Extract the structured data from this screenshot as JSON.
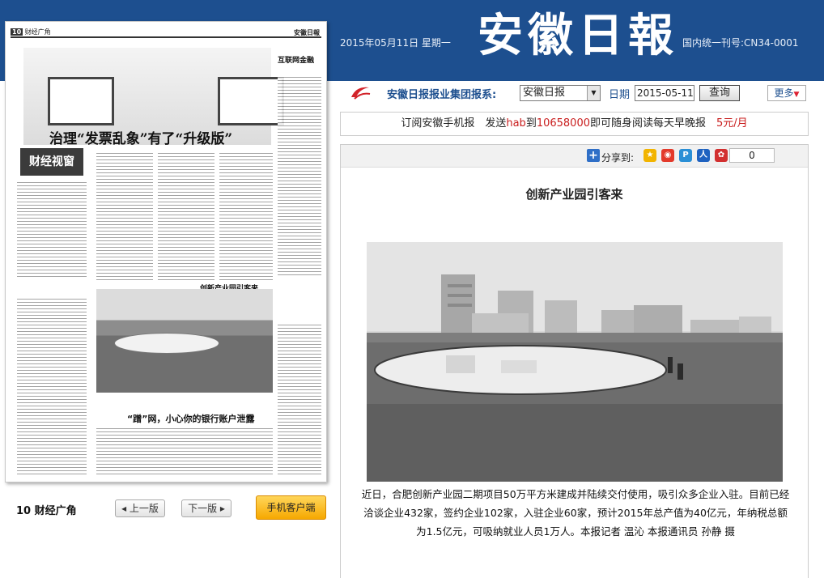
{
  "header": {
    "date": "2015年05月11日 星期一",
    "logo_text": "安徽日報",
    "issn": "国内统一刊号:CN34-0001"
  },
  "search_bar": {
    "group_label": "安徽日报报业集团报系:",
    "paper_selected": "安徽日报",
    "date_label": "日期",
    "date_value": "2015-05-11",
    "query_label": "查询",
    "more_label": "更多"
  },
  "subscribe": {
    "text_a": "订阅安徽手机报　发送",
    "code": "hab",
    "text_b": "到",
    "number": "10658000",
    "text_c": "即可随身阅读每天早晚报　",
    "price": "5元/月"
  },
  "share": {
    "label": "分享到:",
    "count": "0",
    "icons": [
      "qzone-icon",
      "weibo-icon",
      "tencent-weibo-icon",
      "renren-icon",
      "kaixin-icon"
    ]
  },
  "article": {
    "title": "创新产业园引客来",
    "caption": "近日，合肥创新产业园二期项目50万平方米建成并陆续交付使用，吸引众多企业入驻。目前已经洽谈企业432家，签约企业102家，入驻企业60家，预计2015年总产值为40亿元，年纳税总额为1.5亿元，可吸纳就业人员1万人。本报记者 温沁 本报通讯员 孙静 摄"
  },
  "page_nav": {
    "page_label": "10 财经广角",
    "prev_label": "上一版",
    "next_label": "下一版",
    "mobile_label": "手机客户端"
  },
  "thumbnail": {
    "page_no": "10",
    "section": "财经广角",
    "masthead": "安徽日報",
    "banner_headline": "治理“发票乱象”有了“升级版”",
    "photo_title": "创新产业园引客来",
    "column_logo": "财经视窗",
    "bottom_headline": "“蹭”网，小心你的银行账户泄露",
    "side_headline": "互联网金融"
  }
}
